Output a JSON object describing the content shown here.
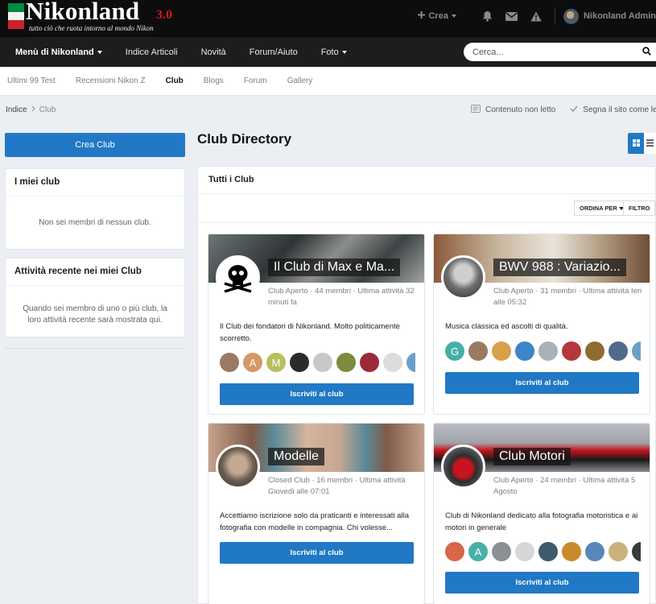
{
  "brand": {
    "title": "Nikonland",
    "version": "3.0",
    "tagline": "tutto ciò che ruota intorno al mondo Nikon",
    "flag_colors": [
      "#008c45",
      "#f4f5f0",
      "#cd212a"
    ]
  },
  "topbar": {
    "create_label": "Crea",
    "user_name": "Nikonland Admin"
  },
  "nav": {
    "items": [
      {
        "label": "Menù di Nikonland"
      },
      {
        "label": "Indice Articoli"
      },
      {
        "label": "Novità"
      },
      {
        "label": "Forum/Aiuto"
      },
      {
        "label": "Foto"
      }
    ],
    "search_placeholder": "Cerca..."
  },
  "subnav": {
    "items": [
      {
        "label": "Ultimi 99 Test"
      },
      {
        "label": "Recensioni Nikon Z"
      },
      {
        "label": "Club"
      },
      {
        "label": "Blogs"
      },
      {
        "label": "Forum"
      },
      {
        "label": "Gallery"
      }
    ]
  },
  "breadcrumb": {
    "home": "Indice",
    "current": "Club",
    "unread_label": "Contenuto non letto",
    "mark_read_label": "Segna il sito come letto"
  },
  "sidebar": {
    "create_club_label": "Crea Club",
    "my_clubs": {
      "title": "I miei club",
      "empty": "Non sei membri di nessun club."
    },
    "recent_activity": {
      "title": "Attività recente nei miei Club",
      "empty": "Quando sei membro di uno o più club, la loro attività recente sarà mostrata qui."
    }
  },
  "main": {
    "title": "Club Directory",
    "panel_title": "Tutti i Club",
    "sort_label": "ORDINA PER",
    "filter_label": "FILTRO",
    "join_label": "Iscriviti al club",
    "accent": "#2178c4"
  },
  "clubs": [
    {
      "name": "Il Club di Max e Ma...",
      "meta": "Club Aperto · 44 membri · Ultima attività 32 minuti fa",
      "description": "Il Club dei fondatori di Nikonland. Molto politicamente scorretto.",
      "member_letters": [
        "",
        "A",
        "M",
        "",
        "",
        "",
        "",
        "",
        ""
      ]
    },
    {
      "name": "BWV 988 : Variazio...",
      "meta": "Club Aperto · 31 membri · Ultima attività Ieri alle 05:32",
      "description": "Musica classica ed ascolti di qualità.",
      "member_letters": [
        "G",
        "",
        "",
        "",
        "",
        "",
        "",
        "",
        ""
      ]
    },
    {
      "name": "Modelle",
      "meta": "Closed Club · 16 membri · Ultima attività Giovedì alle 07:01",
      "description": "Accettiamo iscrizione solo da praticanti e interessati alla fotografia con modelle in compagnia. Chi volesse...",
      "member_letters": []
    },
    {
      "name": "Club Motori",
      "meta": "Club Aperto · 24 membri · Ultima attività 5 Agosto",
      "description": "Club di Nikonland dedicato alla fotografia motoristica e ai motori in generale",
      "member_letters": [
        "",
        "A",
        "",
        "",
        "",
        "",
        "",
        "",
        ""
      ]
    }
  ]
}
